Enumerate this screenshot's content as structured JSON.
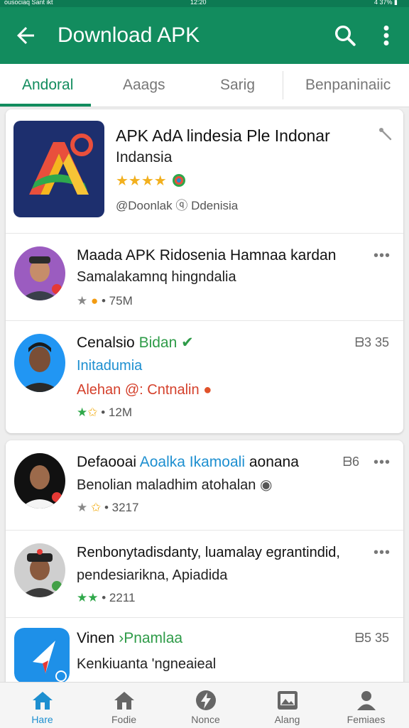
{
  "status_bar": {
    "left": "ousociaq Sant ikt",
    "time": "12:20",
    "right": "4 37% ▮"
  },
  "app_bar": {
    "title": "Download APK"
  },
  "tabs": [
    {
      "label": "Andoral",
      "active": true
    },
    {
      "label": "Aaags",
      "active": false
    },
    {
      "label": "Sarig",
      "active": false
    },
    {
      "label": "Benpaninaiic",
      "active": false
    }
  ],
  "featured": {
    "title": "APK AdA lindesia Ple Indonar",
    "subtitle": "Indansia",
    "rating_stars": 4,
    "footer": "@Doonlak ⓠ Ddenisia"
  },
  "list_card_1": [
    {
      "name": "Maada APK Ridosenia Hamnaa kardan",
      "desc": "Samalakamnq hingndalia",
      "meta": "• 75M"
    },
    {
      "name_main": "Cenalsio",
      "name_tag": "Bidan",
      "verified": "✔",
      "sub_blue": "Initadumia",
      "sub_red": "Alehan @: Cntnalin",
      "meta": "• 12M",
      "right": "ᗷ3  35"
    }
  ],
  "list_card_2": [
    {
      "name_main": "Defaooai",
      "name_tag": "Aoalka Ikamoali",
      "name_rest": " aonana",
      "desc": "Benolian maladhim atohalan",
      "meta": "• 3217",
      "right": "ᗷ6"
    },
    {
      "name": "Renbonytadisdanty, luamalay egrantindid,",
      "desc": "pendesiarikna, Apiadida",
      "meta": "• 2211"
    },
    {
      "name_main": "Vinen",
      "name_tag": "Pnamlaa",
      "desc": "Kenkiuanta 'ngneaieal",
      "right": "ᗷ5  35"
    }
  ],
  "bottom_nav": [
    {
      "label": "Hare",
      "active": true,
      "icon": "home-icon"
    },
    {
      "label": "Fodie",
      "active": false,
      "icon": "home-icon"
    },
    {
      "label": "Nonce",
      "active": false,
      "icon": "bolt-icon"
    },
    {
      "label": "Alang",
      "active": false,
      "icon": "image-icon"
    },
    {
      "label": "Femiaes",
      "active": false,
      "icon": "person-icon"
    }
  ],
  "colors": {
    "primary": "#128c5e",
    "accent_blue": "#1d8fd0",
    "star": "#f2b01e"
  }
}
